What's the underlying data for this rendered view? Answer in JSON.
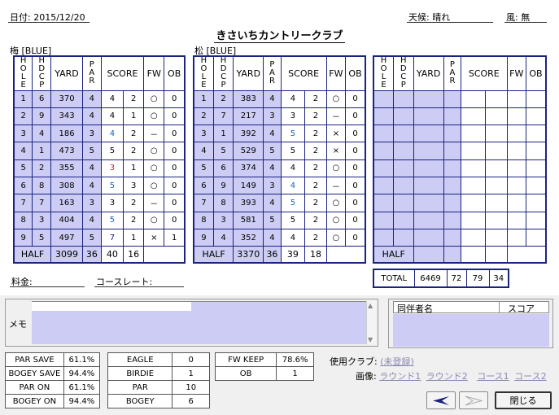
{
  "header": {
    "date_label": "日付: 2015/12/20",
    "weather_label": "天候: 晴れ",
    "wind_label": "風: 無",
    "club_name": "きさいちカントリークラブ"
  },
  "columns": [
    "HOLE",
    "HDCP",
    "YARD",
    "PAR",
    "SCORE",
    "FW",
    "OB"
  ],
  "course1": {
    "label": "梅 [BLUE]",
    "holes": [
      {
        "hole": "1",
        "hdcp": "6",
        "yard": "370",
        "par": "4",
        "score": "4",
        "putt": "2",
        "fw": "○",
        "ob": "0"
      },
      {
        "hole": "2",
        "hdcp": "9",
        "yard": "343",
        "par": "4",
        "score": "4",
        "putt": "1",
        "fw": "○",
        "ob": "0"
      },
      {
        "hole": "3",
        "hdcp": "4",
        "yard": "186",
        "par": "3",
        "score": "4",
        "putt": "2",
        "fw": "－",
        "ob": "0"
      },
      {
        "hole": "4",
        "hdcp": "1",
        "yard": "473",
        "par": "5",
        "score": "5",
        "putt": "2",
        "fw": "○",
        "ob": "0"
      },
      {
        "hole": "5",
        "hdcp": "2",
        "yard": "355",
        "par": "4",
        "score": "3",
        "putt": "1",
        "fw": "○",
        "ob": "0"
      },
      {
        "hole": "6",
        "hdcp": "8",
        "yard": "308",
        "par": "4",
        "score": "5",
        "putt": "3",
        "fw": "○",
        "ob": "0"
      },
      {
        "hole": "7",
        "hdcp": "7",
        "yard": "163",
        "par": "3",
        "score": "3",
        "putt": "2",
        "fw": "－",
        "ob": "0"
      },
      {
        "hole": "8",
        "hdcp": "3",
        "yard": "404",
        "par": "4",
        "score": "5",
        "putt": "2",
        "fw": "○",
        "ob": "0"
      },
      {
        "hole": "9",
        "hdcp": "5",
        "yard": "497",
        "par": "5",
        "score": "7",
        "putt": "1",
        "fw": "×",
        "ob": "1"
      }
    ],
    "half": {
      "label": "HALF",
      "yard": "3099",
      "par": "36",
      "score": "40",
      "putt": "16"
    }
  },
  "course2": {
    "label": "松 [BLUE]",
    "holes": [
      {
        "hole": "1",
        "hdcp": "2",
        "yard": "383",
        "par": "4",
        "score": "4",
        "putt": "2",
        "fw": "○",
        "ob": "0"
      },
      {
        "hole": "2",
        "hdcp": "7",
        "yard": "217",
        "par": "3",
        "score": "3",
        "putt": "2",
        "fw": "－",
        "ob": "0"
      },
      {
        "hole": "3",
        "hdcp": "1",
        "yard": "392",
        "par": "4",
        "score": "5",
        "putt": "2",
        "fw": "×",
        "ob": "0"
      },
      {
        "hole": "4",
        "hdcp": "5",
        "yard": "529",
        "par": "5",
        "score": "5",
        "putt": "2",
        "fw": "×",
        "ob": "0"
      },
      {
        "hole": "5",
        "hdcp": "6",
        "yard": "374",
        "par": "4",
        "score": "4",
        "putt": "2",
        "fw": "○",
        "ob": "0"
      },
      {
        "hole": "6",
        "hdcp": "9",
        "yard": "149",
        "par": "3",
        "score": "4",
        "putt": "2",
        "fw": "－",
        "ob": "0"
      },
      {
        "hole": "7",
        "hdcp": "8",
        "yard": "393",
        "par": "4",
        "score": "5",
        "putt": "2",
        "fw": "○",
        "ob": "0"
      },
      {
        "hole": "8",
        "hdcp": "3",
        "yard": "581",
        "par": "5",
        "score": "5",
        "putt": "2",
        "fw": "○",
        "ob": "0"
      },
      {
        "hole": "9",
        "hdcp": "4",
        "yard": "352",
        "par": "4",
        "score": "4",
        "putt": "2",
        "fw": "○",
        "ob": "0"
      }
    ],
    "half": {
      "label": "HALF",
      "yard": "3370",
      "par": "36",
      "score": "39",
      "putt": "18"
    }
  },
  "course3": {
    "holes": 9,
    "half": {
      "label": "HALF"
    }
  },
  "total": {
    "label": "TOTAL",
    "yard": "6469",
    "par": "72",
    "score": "79",
    "putt": "34"
  },
  "fee_label": "料金:",
  "course_rate_label": "コースレート:",
  "memo_label": "メモ",
  "companions": {
    "name_header": "同伴者名",
    "score_header": "スコア"
  },
  "stats1": [
    {
      "label": "PAR SAVE",
      "value": "61.1%"
    },
    {
      "label": "BOGEY SAVE",
      "value": "94.4%"
    },
    {
      "label": "PAR ON",
      "value": "61.1%"
    },
    {
      "label": "BOGEY ON",
      "value": "94.4%"
    }
  ],
  "stats2": [
    {
      "label": "EAGLE",
      "value": "0"
    },
    {
      "label": "BIRDIE",
      "value": "1"
    },
    {
      "label": "PAR",
      "value": "10"
    },
    {
      "label": "BOGEY",
      "value": "6"
    }
  ],
  "stats3": [
    {
      "label": "FW KEEP",
      "value": "78.6%"
    },
    {
      "label": "OB",
      "value": "1"
    }
  ],
  "usage": {
    "clubs_label": "使用クラブ:",
    "clubs_link": "(未登録)",
    "image_label": "画像:",
    "image_links": [
      "ラウンド1",
      "ラウンド2",
      "コース1",
      "コース2"
    ]
  },
  "buttons": {
    "close": "閉じる"
  },
  "colors": {
    "navy": "#1a237e",
    "lavender": "#ccccf4",
    "birdie_red": "#c62828",
    "over_blue": "#1565c0"
  }
}
